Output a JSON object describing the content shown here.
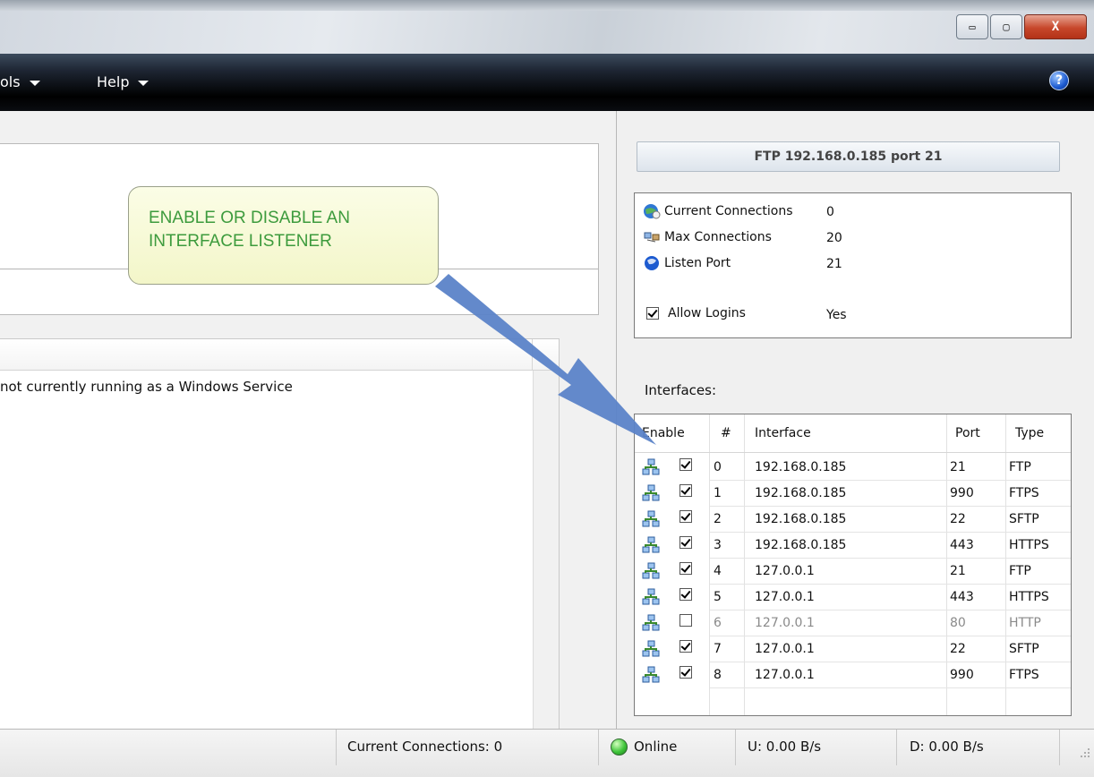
{
  "window": {
    "controls": {
      "minimize": "▭",
      "maximize": "▢",
      "close": "X"
    }
  },
  "menubar": {
    "items": [
      {
        "label": "ols"
      },
      {
        "label": "Help"
      }
    ],
    "help_icon": "?"
  },
  "left": {
    "service_message": "not currently running as a Windows Service"
  },
  "callout": {
    "lines": [
      "ENABLE OR DISABLE AN",
      "INTERFACE LISTENER"
    ]
  },
  "server": {
    "header": "FTP 192.168.0.185 port 21",
    "stats": [
      {
        "label": "Current Connections",
        "value": "0",
        "icon": "connections-globe-icon"
      },
      {
        "label": "Max Connections",
        "value": "20",
        "icon": "max-connections-icon"
      },
      {
        "label": "Listen Port",
        "value": "21",
        "icon": "listen-port-globe-icon"
      }
    ],
    "allow_logins": {
      "label": "Allow Logins",
      "value": "Yes",
      "checked": true
    }
  },
  "interfaces": {
    "label": "Interfaces:",
    "columns": {
      "enable": "Enable",
      "num": "#",
      "interface": "Interface",
      "port": "Port",
      "type": "Type"
    },
    "rows": [
      {
        "num": "0",
        "interface": "192.168.0.185",
        "port": "21",
        "type": "FTP",
        "enabled": true
      },
      {
        "num": "1",
        "interface": "192.168.0.185",
        "port": "990",
        "type": "FTPS",
        "enabled": true
      },
      {
        "num": "2",
        "interface": "192.168.0.185",
        "port": "22",
        "type": "SFTP",
        "enabled": true
      },
      {
        "num": "3",
        "interface": "192.168.0.185",
        "port": "443",
        "type": "HTTPS",
        "enabled": true
      },
      {
        "num": "4",
        "interface": "127.0.0.1",
        "port": "21",
        "type": "FTP",
        "enabled": true
      },
      {
        "num": "5",
        "interface": "127.0.0.1",
        "port": "443",
        "type": "HTTPS",
        "enabled": true
      },
      {
        "num": "6",
        "interface": "127.0.0.1",
        "port": "80",
        "type": "HTTP",
        "enabled": false
      },
      {
        "num": "7",
        "interface": "127.0.0.1",
        "port": "22",
        "type": "SFTP",
        "enabled": true
      },
      {
        "num": "8",
        "interface": "127.0.0.1",
        "port": "990",
        "type": "FTPS",
        "enabled": true
      }
    ]
  },
  "statusbar": {
    "connections": "Current Connections: 0",
    "status": "Online",
    "upload": "U: 0.00 B/s",
    "download": "D: 0.00 B/s"
  },
  "colors": {
    "callout_text": "#3d9b3d",
    "callout_arrow": "#5b83c8",
    "online": "#3fc53a"
  }
}
